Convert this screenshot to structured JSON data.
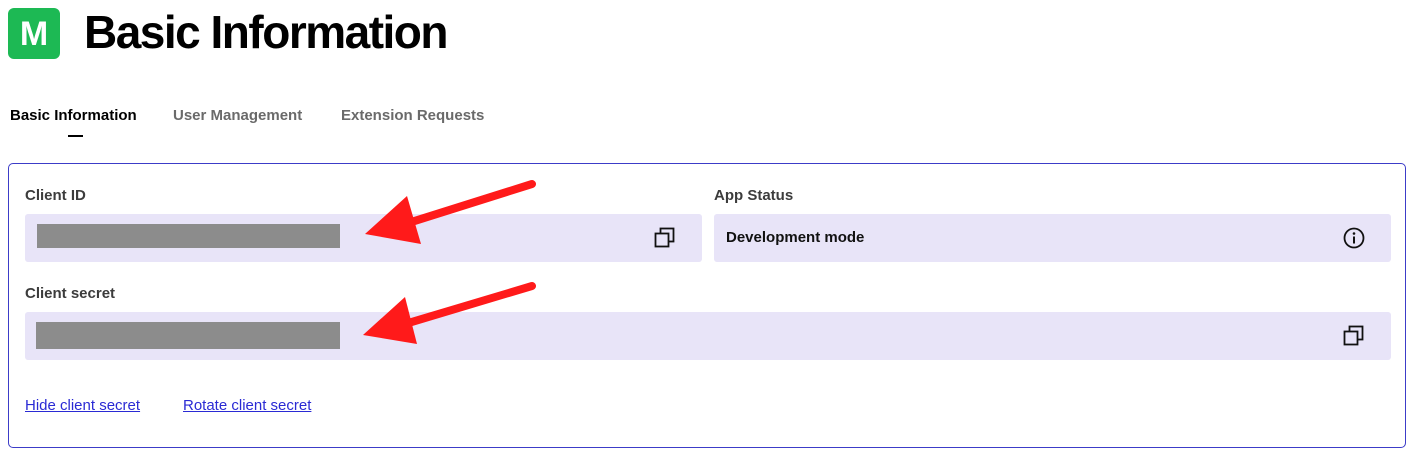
{
  "app": {
    "logo_letter": "M",
    "title": "Basic Information"
  },
  "tabs": [
    {
      "label": "Basic Information",
      "active": true
    },
    {
      "label": "User Management",
      "active": false
    },
    {
      "label": "Extension Requests",
      "active": false
    }
  ],
  "fields": {
    "client_id": {
      "label": "Client ID",
      "value_redacted": true
    },
    "app_status": {
      "label": "App Status",
      "value": "Development mode"
    },
    "client_secret": {
      "label": "Client secret",
      "value_redacted": true
    }
  },
  "links": {
    "hide_secret": "Hide client secret",
    "rotate_secret": "Rotate client secret"
  },
  "icons": {
    "copy": "copy-icon",
    "info": "info-icon",
    "annotation_arrow": "arrow-icon"
  },
  "colors": {
    "logo_green": "#1db954",
    "field_bg": "#e8e4f8",
    "card_border": "#3c3cc8",
    "link": "#2a2ad4",
    "arrow": "#ff1a1a",
    "redaction": "#8c8c8c"
  }
}
